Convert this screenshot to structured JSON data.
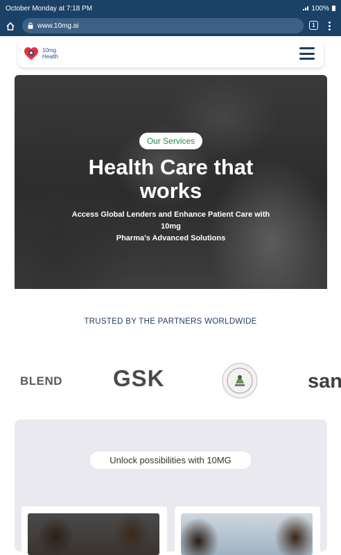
{
  "status_bar": {
    "time_text": "October Monday at 7:18 PM",
    "battery_text": "100%"
  },
  "browser": {
    "url": "www.10mg.ai",
    "tab_count": "1"
  },
  "nav": {
    "logo_line1": "10mg",
    "logo_line2": "Health",
    "menu_icon": "hamburger-icon"
  },
  "hero": {
    "badge": "Our Services",
    "title_line1": "Health Care that",
    "title_line2": "works",
    "subtitle_line1": "Access Global Lenders and Enhance Patient Care with 10mg",
    "subtitle_line2": "Pharma's Advanced Solutions"
  },
  "partners": {
    "heading": "TRUSTED BY THE PARTNERS WORLDWIDE",
    "logos": [
      "BLEND",
      "GSK",
      "NAFDAC",
      "san"
    ]
  },
  "services": {
    "pill": "Unlock possibilities with 10MG"
  },
  "colors": {
    "browser_bar": "#1b4166",
    "brand_navy": "#1e3b5c",
    "badge_green": "#1f8a4c",
    "logo_red": "#e8303a",
    "logo_blue": "#2a4d8f",
    "section_bg": "#e9e9ef"
  }
}
